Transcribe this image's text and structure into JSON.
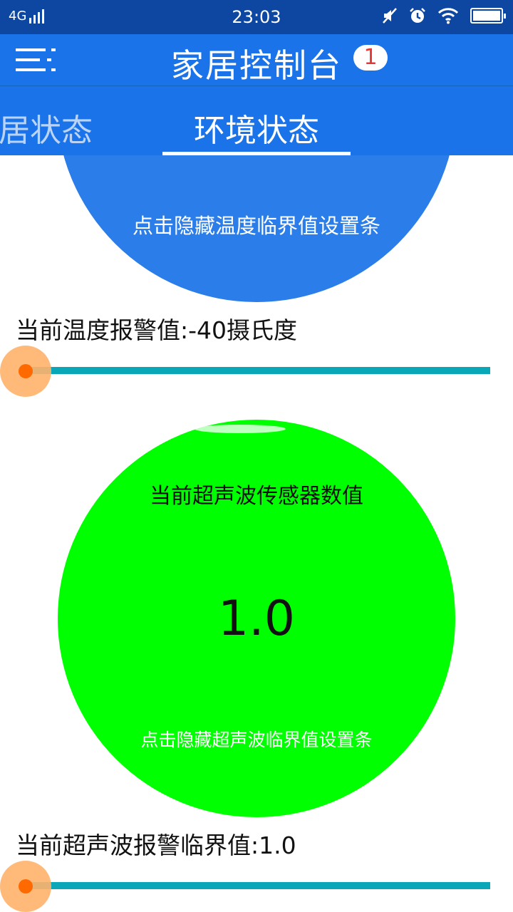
{
  "status_bar": {
    "network": "4G",
    "time": "23:03",
    "icons": [
      "signal-icon",
      "mute-icon",
      "alarm-icon",
      "wifi-icon",
      "battery-icon"
    ]
  },
  "app_bar": {
    "title": "家居控制台",
    "badge_count": "1",
    "menu_icon": "menu-icon"
  },
  "tabs": [
    {
      "label": "家居状态",
      "visible_label": "居状态",
      "active": false
    },
    {
      "label": "环境状态",
      "active": true
    }
  ],
  "temperature": {
    "circle_hint": "点击隐藏温度临界值设置条",
    "alarm_label": "当前温度报警值:-40摄氏度",
    "slider_level": 0
  },
  "ultrasonic": {
    "title": "当前超声波传感器数值",
    "value": "1.0",
    "circle_hint": "点击隐藏超声波临界值设置条",
    "alarm_label": "当前超声波报警临界值:1.0",
    "slider_level": 0
  },
  "colors": {
    "status_bar": "#0d47a1",
    "primary": "#1a73e8",
    "temp_circle": "#2b7de9",
    "ultrasonic_circle": "#00ff00",
    "slider_track": "#0aa7b8",
    "slider_thumb": "#ff6a00",
    "badge_text": "#e53935"
  }
}
